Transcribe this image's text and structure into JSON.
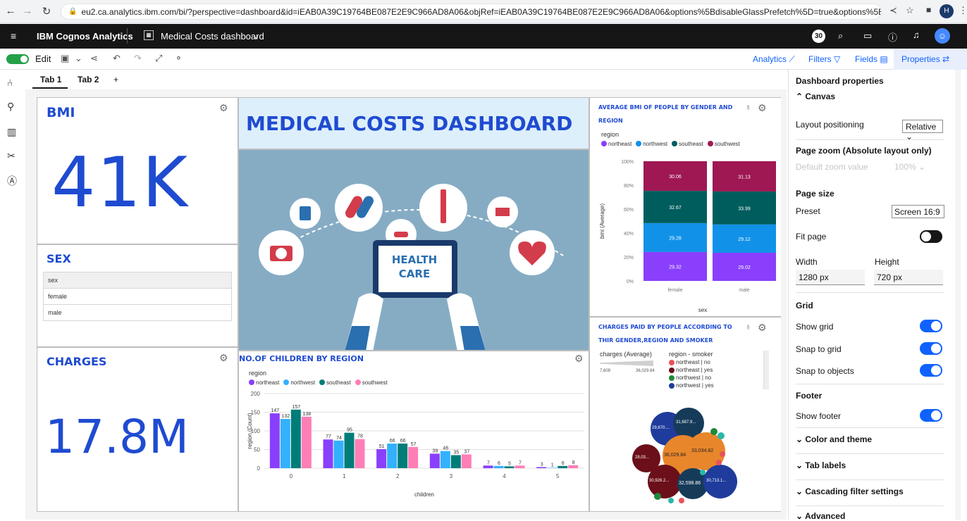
{
  "browser": {
    "url": "eu2.ca.analytics.ibm.com/bi/?perspective=dashboard&id=iEAB0A39C19764BE087E2E9C966AD8A06&objRef=iEAB0A39C19764BE087E2E9C966AD8A06&options%5BdisableGlassPrefetch%5D=true&options%5Bcollections%5D%5BcanvasE..."
  },
  "appbar": {
    "product": "IBM Cognos Analytics",
    "dashboard_name": "Medical Costs dashboard",
    "notification_count": "30",
    "user_initial": "H"
  },
  "toolbar": {
    "edit_label": "Edit",
    "analytics_label": "Analytics",
    "filters_label": "Filters",
    "fields_label": "Fields",
    "properties_label": "Properties"
  },
  "tabs": [
    {
      "label": "Tab 1"
    },
    {
      "label": "Tab 2"
    }
  ],
  "add_tab": "+",
  "widgets": {
    "bmi": {
      "title": "BMI",
      "value": "41K"
    },
    "sex": {
      "title": "SEX",
      "items": [
        "sex",
        "female",
        "male"
      ]
    },
    "charges": {
      "title": "CHARGES",
      "value": "17.8M"
    },
    "banner": {
      "title": "MEDICAL COSTS DASHBOARD",
      "sign_line1": "HEALTH",
      "sign_line2": "CARE"
    }
  },
  "bmi_chart": {
    "title_line1": "AVERAGE BMI OF PEOPLE BY GENDER AND",
    "title_line2": "REGION",
    "legend_title": "region",
    "xlabel": "sex",
    "ylabel": "bmi (Average)"
  },
  "children_chart": {
    "title": "NO.OF CHILDREN BY REGION",
    "legend_title": "region",
    "xlabel": "children",
    "ylabel": "region (Count)"
  },
  "charges_chart": {
    "title_line1": "CHARGES PAID BY PEOPLE ACCORDING TO",
    "title_line2": "THIR GENDER,REGION AND SMOKER",
    "size_legend_title": "charges (Average)",
    "size_min": "7,609",
    "size_max": "36,029.84",
    "color_legend_title": "region - smoker",
    "color_legend": [
      {
        "label": "northeast | no",
        "color": "#e8525d"
      },
      {
        "label": "northeast | yes",
        "color": "#6b0f1a"
      },
      {
        "label": "northwest | no",
        "color": "#1e8a3c"
      },
      {
        "label": "northwest | yes",
        "color": "#1f3c9c"
      }
    ],
    "bubble_labels": [
      "29,670....",
      "31,687.9...",
      "36,029.84",
      "33,034.82",
      "28,03...",
      "30,926.2...",
      "32,598.86",
      "30,713.1..."
    ]
  },
  "chart_data": [
    {
      "type": "bar",
      "stacked": "100%",
      "categories": [
        "female",
        "male"
      ],
      "series": [
        {
          "name": "northeast",
          "color": "#8a3ffc",
          "values": [
            29.32,
            29.02
          ]
        },
        {
          "name": "northwest",
          "color": "#1192e8",
          "values": [
            29.28,
            29.12
          ]
        },
        {
          "name": "southeast",
          "color": "#005d5d",
          "values": [
            32.67,
            33.99
          ]
        },
        {
          "name": "southwest",
          "color": "#9f1853",
          "values": [
            30.06,
            31.13
          ]
        }
      ],
      "yticks": [
        "0%",
        "20%",
        "40%",
        "60%",
        "80%",
        "100%"
      ]
    },
    {
      "type": "bar",
      "categories": [
        "0",
        "1",
        "2",
        "3",
        "4",
        "5"
      ],
      "series": [
        {
          "name": "northeast",
          "color": "#8a3ffc",
          "values": [
            147,
            77,
            51,
            39,
            7,
            3
          ]
        },
        {
          "name": "northwest",
          "color": "#33b1ff",
          "values": [
            132,
            74,
            66,
            46,
            6,
            1
          ]
        },
        {
          "name": "southeast",
          "color": "#007d79",
          "values": [
            157,
            95,
            66,
            35,
            5,
            6
          ]
        },
        {
          "name": "southwest",
          "color": "#ff7eb6",
          "values": [
            138,
            78,
            57,
            37,
            7,
            8
          ]
        }
      ],
      "yticks": [
        "0",
        "50",
        "100",
        "150",
        "200"
      ],
      "ylim": [
        0,
        200
      ]
    }
  ],
  "properties": {
    "title": "Dashboard properties",
    "canvas": "Canvas",
    "layout_positioning": "Layout positioning",
    "layout_value": "Relative",
    "page_zoom": "Page zoom (Absolute layout only)",
    "default_zoom": "Default zoom value",
    "zoom_value": "100%",
    "page_size": "Page size",
    "preset": "Preset",
    "preset_value": "Screen 16:9",
    "fit_page": "Fit page",
    "width": "Width",
    "height": "Height",
    "width_value": "1280 px",
    "height_value": "720 px",
    "grid": "Grid",
    "show_grid": "Show grid",
    "snap_to_grid": "Snap to grid",
    "snap_to_objects": "Snap to objects",
    "footer": "Footer",
    "show_footer": "Show footer",
    "color_theme": "Color and theme",
    "tab_labels": "Tab labels",
    "cascading": "Cascading filter settings",
    "advanced": "Advanced"
  }
}
